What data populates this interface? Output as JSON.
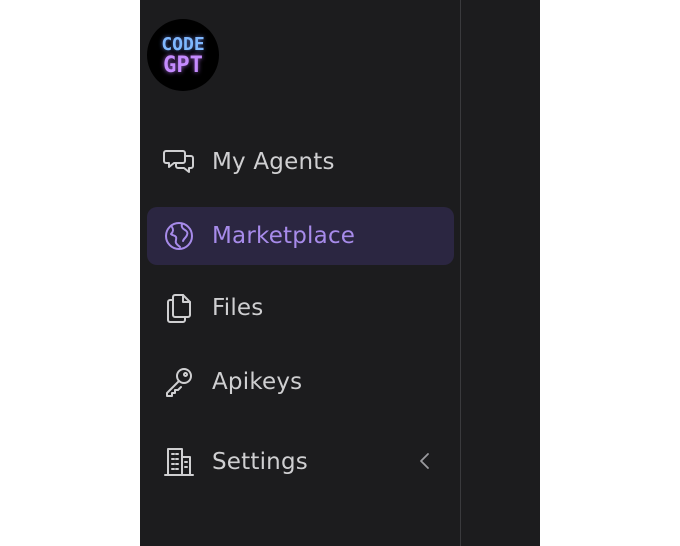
{
  "app": {
    "logo": {
      "line1": "CODE",
      "line2": "GPT"
    }
  },
  "sidebar": {
    "items": [
      {
        "label": "My Agents",
        "icon": "chat-bubbles-icon",
        "active": false
      },
      {
        "label": "Marketplace",
        "icon": "globe-icon",
        "active": true
      },
      {
        "label": "Files",
        "icon": "files-icon",
        "active": false
      },
      {
        "label": "Apikeys",
        "icon": "key-icon",
        "active": false
      },
      {
        "label": "Settings",
        "icon": "building-icon",
        "active": false,
        "expand_icon": "chevron-left-icon"
      }
    ]
  },
  "colors": {
    "sidebar_bg": "#1c1c1e",
    "active_bg": "#2b2641",
    "accent": "#a78bea",
    "text": "#cfcfd1"
  }
}
